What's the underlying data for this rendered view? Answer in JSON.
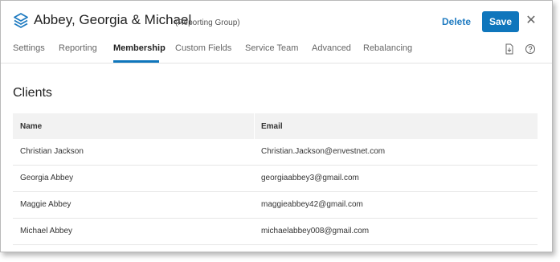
{
  "header": {
    "title": "Abbey, Georgia & Michael",
    "subtitle": "(Reporting Group)",
    "delete_label": "Delete",
    "save_label": "Save",
    "close_glyph": "✕",
    "logo_icon": "layers-icon",
    "accent_color": "#0f76bc"
  },
  "tabs": [
    {
      "label": "Settings",
      "active": false
    },
    {
      "label": "Reporting",
      "active": false
    },
    {
      "label": "Membership",
      "active": true
    },
    {
      "label": "Custom Fields",
      "active": false
    },
    {
      "label": "Service Team",
      "active": false
    },
    {
      "label": "Advanced",
      "active": false
    },
    {
      "label": "Rebalancing",
      "active": false
    }
  ],
  "toolbar_icons": [
    "export-document-icon",
    "help-icon"
  ],
  "section": {
    "title": "Clients"
  },
  "table": {
    "columns": [
      "Name",
      "Email"
    ],
    "rows": [
      {
        "name": "Christian Jackson",
        "email": "Christian.Jackson@envestnet.com"
      },
      {
        "name": "Georgia Abbey",
        "email": "georgiaabbey3@gmail.com"
      },
      {
        "name": "Maggie Abbey",
        "email": "maggieabbey42@gmail.com"
      },
      {
        "name": "Michael Abbey",
        "email": "michaelabbey008@gmail.com"
      }
    ]
  }
}
